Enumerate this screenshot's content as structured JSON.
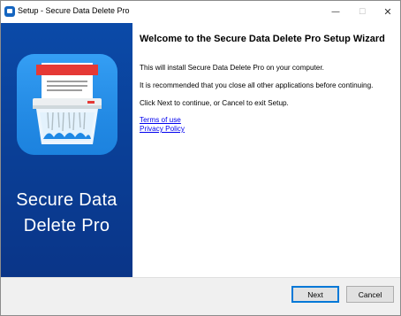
{
  "window": {
    "title": "Setup - Secure Data Delete Pro",
    "icon": "setup-app-icon",
    "caption_buttons": {
      "minimize": "—",
      "maximize": "☐",
      "close": "✕"
    }
  },
  "banner": {
    "art": {
      "icon": "paper-shredder-icon",
      "label": "CONFIDENTIAL",
      "colors": {
        "background": "#0b4aa8",
        "tile": "#2196f3",
        "label": "#e53935"
      }
    },
    "product_line1": "Secure Data",
    "product_line2": "Delete Pro"
  },
  "content": {
    "heading": "Welcome to the Secure Data Delete Pro Setup Wizard",
    "paragraphs": [
      "This will install Secure Data Delete Pro on your computer.",
      "It is recommended that you close all other applications before continuing.",
      "Click Next to continue, or Cancel to exit Setup."
    ],
    "links": [
      "Terms of use",
      "Privacy Policy"
    ]
  },
  "footer": {
    "next_label": "Next",
    "cancel_label": "Cancel"
  }
}
